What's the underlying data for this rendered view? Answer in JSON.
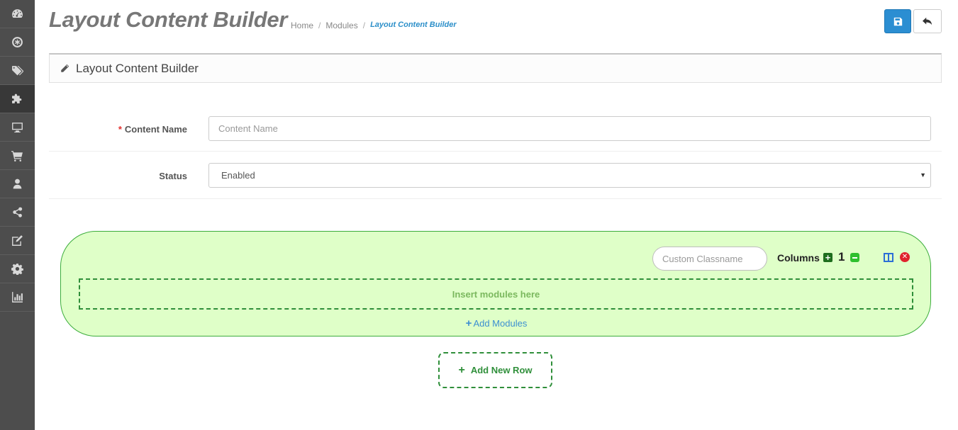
{
  "header": {
    "title": "Layout Content Builder",
    "breadcrumb": [
      "Home",
      "Modules",
      "Layout Content Builder"
    ]
  },
  "sidebar": {
    "items": [
      {
        "icon": "dashboard-icon"
      },
      {
        "icon": "catalog-icon"
      },
      {
        "icon": "tags-icon"
      },
      {
        "icon": "extensions-icon",
        "active": true
      },
      {
        "icon": "design-icon"
      },
      {
        "icon": "sales-icon"
      },
      {
        "icon": "customers-icon"
      },
      {
        "icon": "marketing-icon"
      },
      {
        "icon": "edit-icon"
      },
      {
        "icon": "settings-icon"
      },
      {
        "icon": "reports-icon"
      }
    ]
  },
  "panel": {
    "heading": "Layout Content Builder"
  },
  "form": {
    "content_name": {
      "required_mark": "*",
      "label": "Content Name",
      "placeholder": "Content Name",
      "value": ""
    },
    "status": {
      "label": "Status",
      "value": "Enabled"
    }
  },
  "builder": {
    "classname_placeholder": "Custom Classname",
    "columns_label": "Columns",
    "column_count": "1",
    "dropzone_text": "Insert modules here",
    "add_modules_label": "Add Modules",
    "add_row_label": "Add New Row"
  },
  "colors": {
    "sidebar": "#4d4d4d",
    "primary": "#2b8ed2",
    "row_bg": "#dfffc8",
    "row_border": "#3cad3c",
    "danger": "#e0232d"
  }
}
